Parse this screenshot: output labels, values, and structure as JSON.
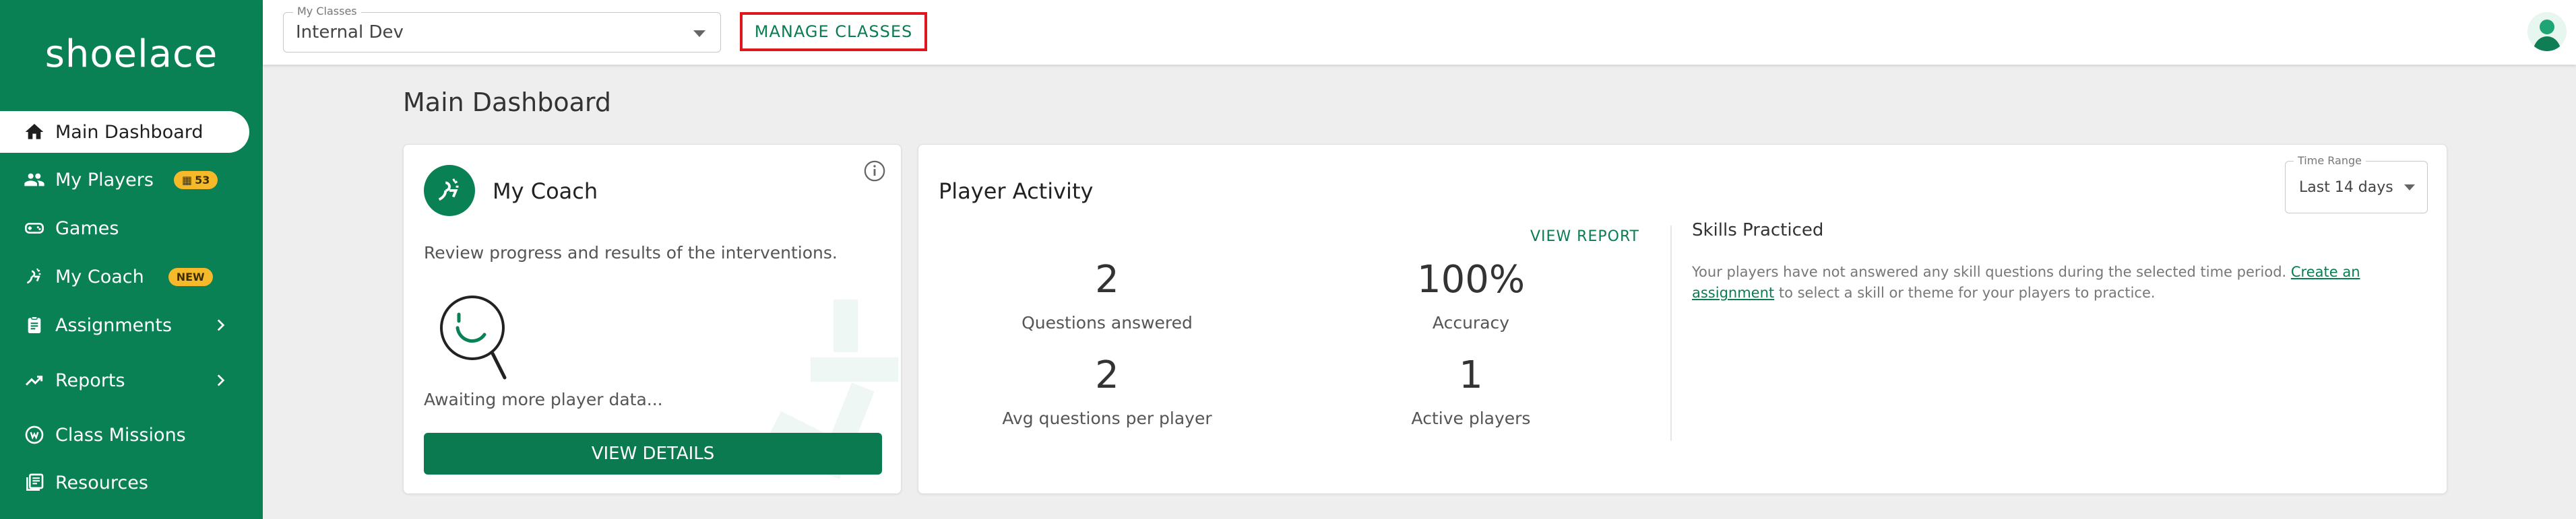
{
  "brand": {
    "logo_text": "shoelace",
    "accent": "#0a8055",
    "badge_color": "#f5b92b"
  },
  "sidebar": {
    "items": [
      {
        "label": "Main Dashboard",
        "icon": "home-icon",
        "active": true
      },
      {
        "label": "My Players",
        "icon": "players-icon",
        "badge": "53"
      },
      {
        "label": "Games",
        "icon": "gamepad-icon"
      },
      {
        "label": "My Coach",
        "icon": "coach-icon",
        "badge": "NEW"
      },
      {
        "label": "Assignments",
        "icon": "clipboard-icon",
        "has_submenu": true
      },
      {
        "label": "Reports",
        "icon": "trending-up-icon",
        "has_submenu": true
      },
      {
        "label": "Class Missions",
        "icon": "mission-icon"
      },
      {
        "label": "Resources",
        "icon": "library-icon"
      }
    ]
  },
  "topbar": {
    "class_select": {
      "legend": "My Classes",
      "value": "Internal Dev"
    },
    "manage_classes_label": "MANAGE CLASSES"
  },
  "main": {
    "title": "Main Dashboard",
    "coach_card": {
      "title": "My Coach",
      "description": "Review progress and results of the interventions.",
      "status": "Awaiting more player data...",
      "button_label": "VIEW DETAILS"
    },
    "activity_card": {
      "title": "Player Activity",
      "view_report_label": "VIEW REPORT",
      "time_range": {
        "legend": "Time Range",
        "value": "Last 14 days"
      },
      "stats": [
        {
          "value": "2",
          "label": "Questions answered"
        },
        {
          "value": "100%",
          "label": "Accuracy"
        },
        {
          "value": "2",
          "label": "Avg questions per player"
        },
        {
          "value": "1",
          "label": "Active players"
        }
      ],
      "skills": {
        "title": "Skills Practiced",
        "text_before": "Your players have not answered any skill questions during the selected time period. ",
        "link_text": "Create an assignment",
        "text_after": " to select a skill or theme for your players to practice."
      }
    }
  }
}
